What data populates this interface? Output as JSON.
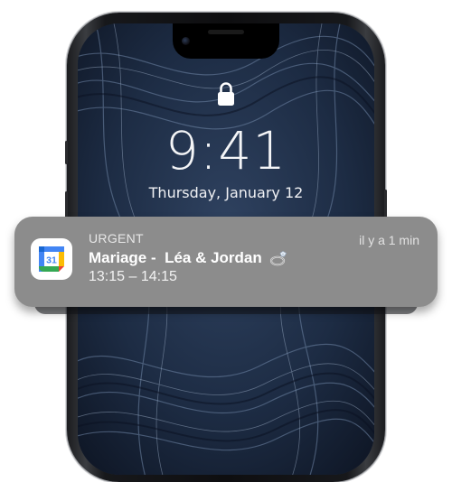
{
  "lockscreen": {
    "time": "9:41",
    "date": "Thursday, January 12",
    "lock_icon": "padlock-icon"
  },
  "notification": {
    "app_icon": "google-calendar-icon",
    "app_icon_day": "31",
    "title": "URGENT",
    "timestamp": "il y a 1 min",
    "subtitle": "Mariage -  Léa & Jordan",
    "subtitle_emoji": "ring-icon",
    "body": "13:15 – 14:15"
  },
  "colors": {
    "notification_bg": "#8c8c8c",
    "wallpaper_base": "#1c2a3e",
    "calendar_blue": "#4285f4",
    "calendar_red": "#ea4335",
    "calendar_yellow": "#fbbc04",
    "calendar_green": "#34a853"
  }
}
